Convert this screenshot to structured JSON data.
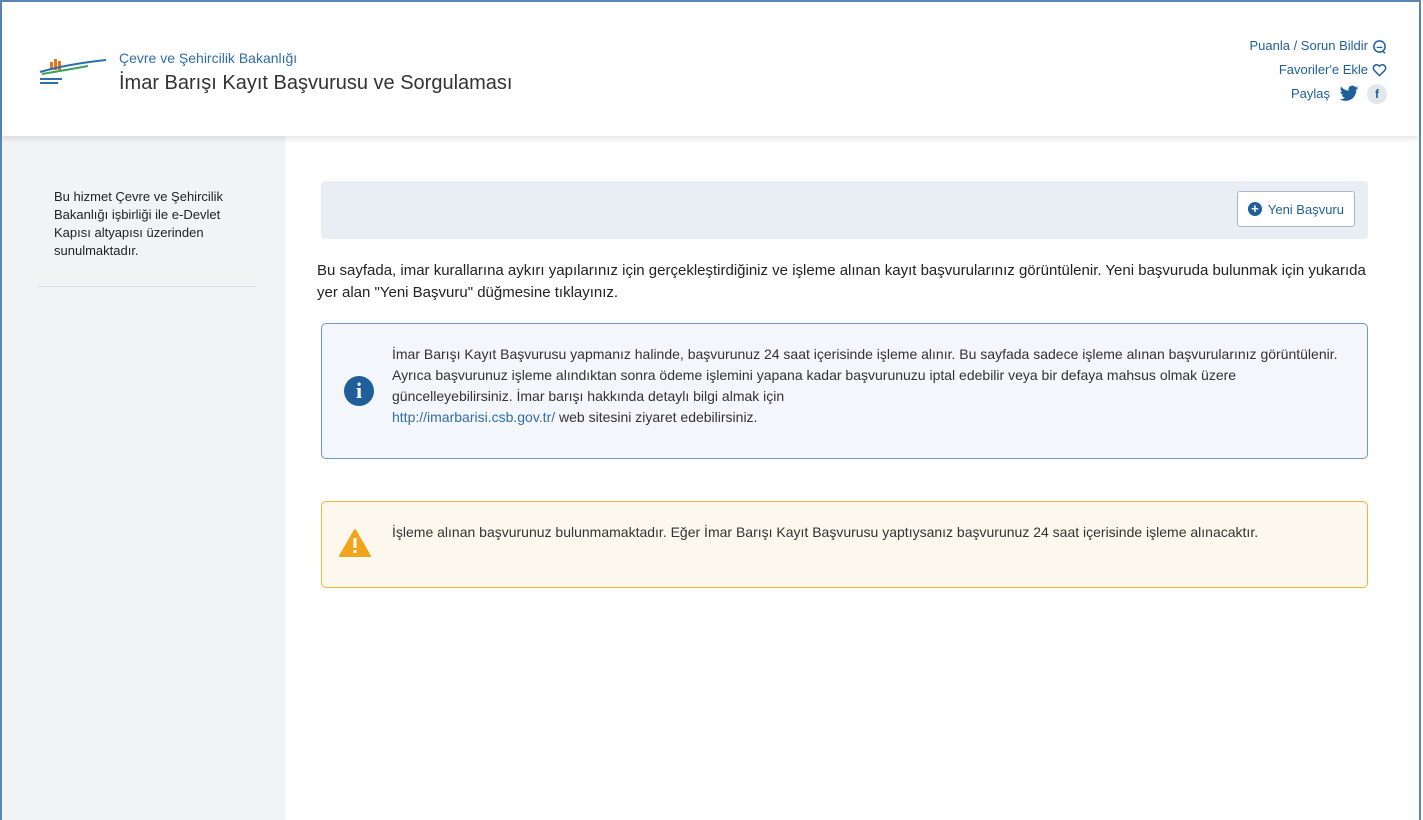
{
  "header": {
    "ministry": "Çevre ve Şehircilik Bakanlığı",
    "service_title": "İmar Barışı Kayıt Başvurusu ve Sorgulaması",
    "rate_report": "Puanla / Sorun Bildir",
    "add_favorites": "Favoriler'e Ekle",
    "share": "Paylaş"
  },
  "sidebar": {
    "text": "Bu hizmet Çevre ve Şehircilik Bakanlığı işbirliği ile e-Devlet Kapısı altyapısı üzerinden sunulmaktadır."
  },
  "toolbar": {
    "new_application": "Yeni Başvuru"
  },
  "main": {
    "intro": "Bu sayfada, imar kurallarına aykırı yapılarınız için gerçekleştirdiğiniz ve işleme alınan kayıt başvurularınız görüntülenir. Yeni başvuruda bulunmak için yukarıda yer alan \"Yeni Başvuru\" düğmesine tıklayınız.",
    "info_text": "İmar Barışı Kayıt Başvurusu yapmanız halinde, başvurunuz 24 saat içerisinde işleme alınır. Bu sayfada sadece işleme alınan başvurularınız görüntülenir. Ayrıca başvurunuz işleme alındıktan sonra ödeme işlemini yapana kadar başvurunuzu iptal edebilir veya bir defaya mahsus olmak üzere güncelleyebilirsiniz. İmar barışı hakkında detaylı bilgi almak için",
    "info_link": "http://imarbarisi.csb.gov.tr/",
    "info_suffix": " web sitesini ziyaret edebilirsiniz.",
    "warning": "İşleme alınan başvurunuz bulunmamaktadır. Eğer İmar Barışı Kayıt Başvurusu yaptıysanız başvurunuz 24 saat içerisinde işleme alınacaktır."
  },
  "colors": {
    "accent": "#1f5f99",
    "info_border": "#6f97c4",
    "warning": "#f0a419"
  },
  "icons": [
    "ministry-logo",
    "feedback-icon",
    "heart-icon",
    "twitter-icon",
    "facebook-icon",
    "plus-circle-icon",
    "info-icon",
    "warning-icon"
  ]
}
